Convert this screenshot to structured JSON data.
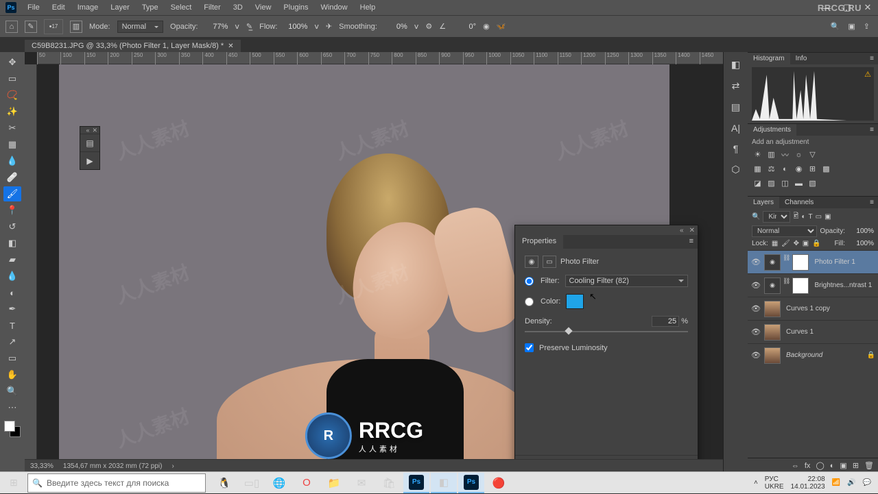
{
  "menubar": {
    "items": [
      "File",
      "Edit",
      "Image",
      "Layer",
      "Type",
      "Select",
      "Filter",
      "3D",
      "View",
      "Plugins",
      "Window",
      "Help"
    ]
  },
  "optionsbar": {
    "brush_size": "17",
    "mode_label": "Mode:",
    "mode_value": "Normal",
    "opacity_label": "Opacity:",
    "opacity_value": "77%",
    "flow_label": "Flow:",
    "flow_value": "100%",
    "smoothing_label": "Smoothing:",
    "smoothing_value": "0%",
    "angle_value": "0°"
  },
  "doctab": {
    "title": "C59B8231.JPG @ 33,3% (Photo Filter 1, Layer Mask/8) *"
  },
  "ruler_ticks": [
    "50",
    "100",
    "150",
    "200",
    "250",
    "300",
    "350",
    "400",
    "450",
    "500",
    "550",
    "600",
    "650",
    "700",
    "750",
    "800",
    "850",
    "900",
    "950",
    "1000",
    "1050",
    "1100",
    "1150",
    "1200",
    "1250",
    "1300",
    "1350",
    "1400",
    "1450"
  ],
  "statusbar": {
    "zoom": "33,33%",
    "docinfo": "1354,67 mm x 2032 mm (72 ppi)"
  },
  "properties": {
    "tab": "Properties",
    "title": "Photo Filter",
    "filter_label": "Filter:",
    "filter_value": "Cooling Filter (82)",
    "color_label": "Color:",
    "color_hex": "#1fa4e8",
    "density_label": "Density:",
    "density_value": "25",
    "density_unit": "%",
    "preserve_label": "Preserve Luminosity",
    "preserve_checked": true
  },
  "histogram_tab": "Histogram",
  "info_tab": "Info",
  "adjustments": {
    "tab": "Adjustments",
    "add_label": "Add an adjustment"
  },
  "layers": {
    "tab_layers": "Layers",
    "tab_channels": "Channels",
    "kind": "Kind",
    "blend": "Normal",
    "opacity_label": "Opacity:",
    "opacity": "100%",
    "lock_label": "Lock:",
    "fill_label": "Fill:",
    "fill": "100%",
    "items": [
      {
        "name": "Photo Filter 1",
        "type": "adj",
        "mask": true,
        "selected": true
      },
      {
        "name": "Brightnes...ntrast 1",
        "type": "adj",
        "mask": true
      },
      {
        "name": "Curves 1 copy",
        "type": "img"
      },
      {
        "name": "Curves 1",
        "type": "img"
      },
      {
        "name": "Background",
        "type": "img",
        "locked": true,
        "italic": true
      }
    ]
  },
  "taskbar": {
    "search_placeholder": "Введите здесь текст для поиска",
    "lang": "РУС",
    "kb": "UKRE",
    "time": "22:08",
    "date": "14.01.2023"
  },
  "brand_corner": "RRCG.RU",
  "canvas_watermark": "人人素材",
  "canvas_logo_text": "RRCG",
  "canvas_logo_sub": "人人素材"
}
